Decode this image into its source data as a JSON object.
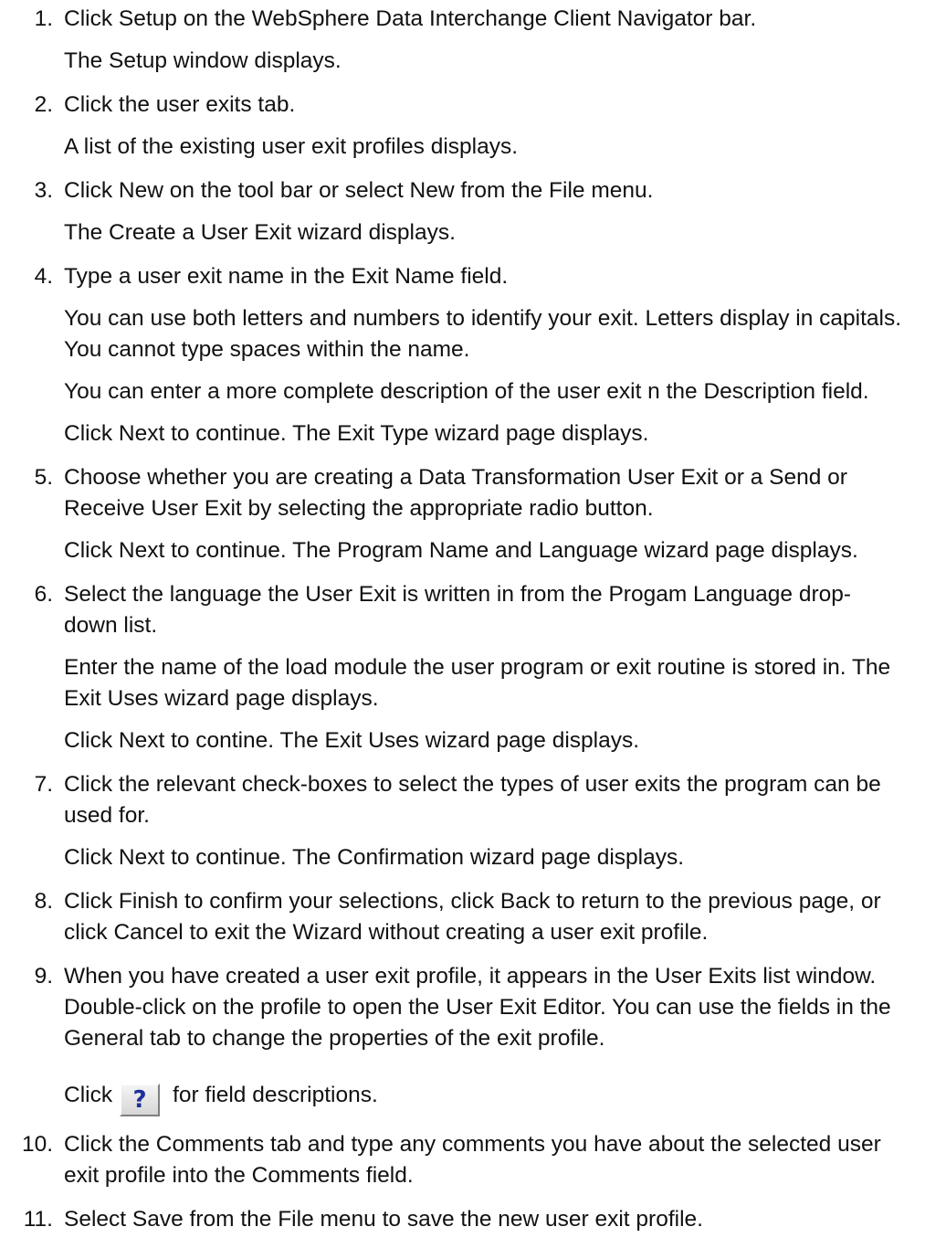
{
  "steps": [
    {
      "number": "1.",
      "text": "Click Setup on the WebSphere Data Interchange Client Navigator bar.",
      "details": [
        "The Setup window displays."
      ]
    },
    {
      "number": "2.",
      "text": "Click the user exits tab.",
      "details": [
        "A list of the existing user exit profiles displays."
      ]
    },
    {
      "number": "3.",
      "text": "Click New on the tool bar or select New from the File menu.",
      "details": [
        "The Create a User Exit wizard displays."
      ]
    },
    {
      "number": "4.",
      "text": "Type a user exit name in the Exit Name field.",
      "details": [
        "You can use both letters and numbers to identify your exit. Letters display in capitals. You cannot type spaces within the name.",
        "You can enter a more complete description of the user exit n the Description field.",
        "Click Next to continue. The Exit Type wizard page displays."
      ]
    },
    {
      "number": "5.",
      "text": "Choose whether you are creating a Data Transformation User Exit or a Send or Receive User Exit by selecting the appropriate radio button.",
      "details": [
        "Click Next to continue. The Program Name and Language wizard page displays."
      ]
    },
    {
      "number": "6.",
      "text": "Select the language the User Exit is written in from the Progam Language drop-down list.",
      "details": [
        "Enter the name of the load module the user program or exit routine is stored in. The Exit Uses wizard page displays.",
        "Click Next to contine. The Exit Uses wizard page displays."
      ]
    },
    {
      "number": "7.",
      "text": "Click the relevant check-boxes to select the types of user exits the program can be used for.",
      "details": [
        "Click Next to continue. The Confirmation wizard page displays."
      ]
    },
    {
      "number": "8.",
      "text": "Click Finish to confirm your selections, click Back to return to the previous page, or click Cancel to exit the Wizard without creating a user exit profile.",
      "details": []
    },
    {
      "number": "9.",
      "text": "When you have created a user exit profile, it appears in the User Exits list window. Double-click on the profile to open the User Exit Editor. You can use the fields in the General tab to change the properties of the exit profile.",
      "details": []
    },
    {
      "number": "10.",
      "text": "Click the Comments tab and type any comments you have about the selected user exit profile into the Comments field.",
      "details": []
    },
    {
      "number": "11.",
      "text": "Select Save from the File menu to save the new user exit profile.",
      "details": []
    }
  ],
  "help_line": {
    "before": "Click",
    "icon": "help-question-icon",
    "glyph": "?",
    "after": "for field descriptions."
  },
  "colors": {
    "text": "#111111",
    "help_glyph": "#1c2f9c"
  }
}
